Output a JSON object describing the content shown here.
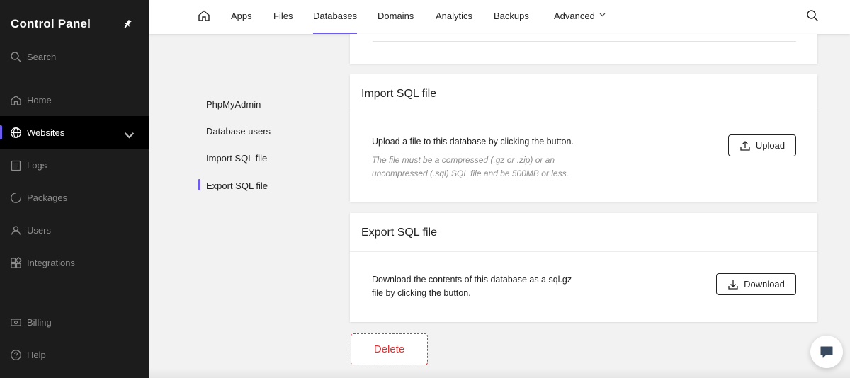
{
  "sidebar": {
    "brand": "Control Panel",
    "search_label": "Search",
    "items": [
      {
        "label": "Home"
      },
      {
        "label": "Websites"
      },
      {
        "label": "Logs"
      },
      {
        "label": "Packages"
      },
      {
        "label": "Users"
      },
      {
        "label": "Integrations"
      },
      {
        "label": "Billing"
      },
      {
        "label": "Help"
      }
    ],
    "active_item": "Websites"
  },
  "topnav": {
    "tabs": [
      {
        "label": "Apps"
      },
      {
        "label": "Files"
      },
      {
        "label": "Databases"
      },
      {
        "label": "Domains"
      },
      {
        "label": "Analytics"
      },
      {
        "label": "Backups"
      },
      {
        "label": "Advanced"
      }
    ],
    "active_tab": "Databases"
  },
  "subnav": {
    "items": [
      {
        "label": "PhpMyAdmin"
      },
      {
        "label": "Database users"
      },
      {
        "label": "Import SQL file"
      },
      {
        "label": "Export SQL file"
      }
    ],
    "active_item": "Export SQL file"
  },
  "import_card": {
    "title": "Import SQL file",
    "description": "Upload a file to this database by clicking the button.",
    "note_line1": "The file must be a compressed (.gz or .zip) or an",
    "note_line2": "uncompressed (.sql) SQL file and be 500MB or less.",
    "button_label": "Upload"
  },
  "export_card": {
    "title": "Export SQL file",
    "description_line1": "Download the contents of this database as a sql.gz",
    "description_line2": "file by clicking the button.",
    "button_label": "Download"
  },
  "delete_label": "Delete",
  "colors": {
    "sidebar_bg": "#1c1c1c",
    "accent": "#6e5cf0",
    "danger": "#dd3333"
  }
}
